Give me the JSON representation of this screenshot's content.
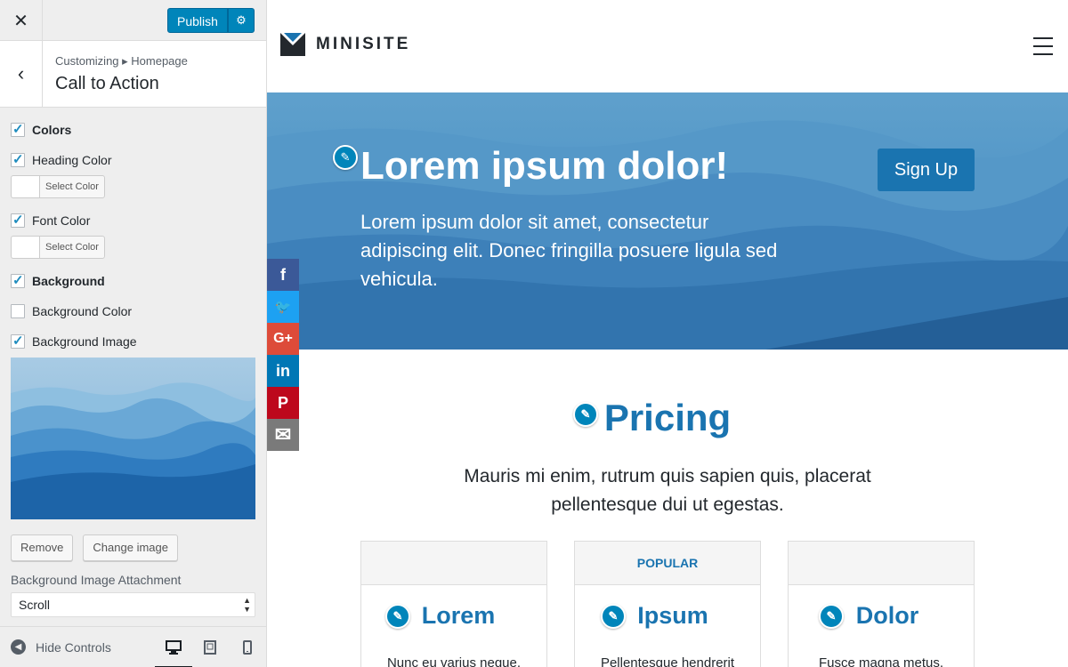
{
  "sidebar": {
    "close_icon": "close-icon",
    "publish_label": "Publish",
    "breadcrumb": "Customizing ▸ Homepage",
    "section_title": "Call to Action",
    "controls": {
      "colors_label": "Colors",
      "heading_color_label": "Heading Color",
      "select_color_label": "Select Color",
      "font_color_label": "Font Color",
      "background_label": "Background",
      "background_color_label": "Background Color",
      "background_image_label": "Background Image",
      "remove_label": "Remove",
      "change_image_label": "Change image",
      "attachment_label": "Background Image Attachment",
      "attachment_value": "Scroll",
      "checked": {
        "colors": true,
        "heading_color": true,
        "font_color": true,
        "background": true,
        "background_color": false,
        "background_image": true
      }
    },
    "footer": {
      "hide_controls_label": "Hide Controls",
      "active_device": "desktop"
    }
  },
  "preview": {
    "logo_text": "MINISITE",
    "hero": {
      "title": "Lorem ipsum dolor!",
      "text": "Lorem ipsum dolor sit amet, consectetur adipiscing elit. Donec fringilla posuere ligula sed vehicula.",
      "button_label": "Sign Up"
    },
    "social": [
      {
        "name": "facebook",
        "glyph": "f",
        "color": "#3b5998"
      },
      {
        "name": "twitter",
        "glyph": "🐦",
        "color": "#1da1f2"
      },
      {
        "name": "google-plus",
        "glyph": "G+",
        "color": "#dd4b39"
      },
      {
        "name": "linkedin",
        "glyph": "in",
        "color": "#0077b5"
      },
      {
        "name": "pinterest",
        "glyph": "P",
        "color": "#bd081c"
      },
      {
        "name": "email",
        "glyph": "✉",
        "color": "#7a7a7a"
      }
    ],
    "pricing": {
      "title": "Pricing",
      "subtitle": "Mauris mi enim, rutrum quis sapien quis, placerat pellentesque dui ut egestas.",
      "cards": [
        {
          "badge": "",
          "title": "Lorem",
          "text": "Nunc eu varius neque."
        },
        {
          "badge": "POPULAR",
          "title": "Ipsum",
          "text": "Pellentesque hendrerit"
        },
        {
          "badge": "",
          "title": "Dolor",
          "text": "Fusce magna metus."
        }
      ]
    }
  },
  "colors": {
    "accent": "#0085ba",
    "brand_blue": "#1a74b0",
    "sidebar_bg": "#eeeeee"
  }
}
